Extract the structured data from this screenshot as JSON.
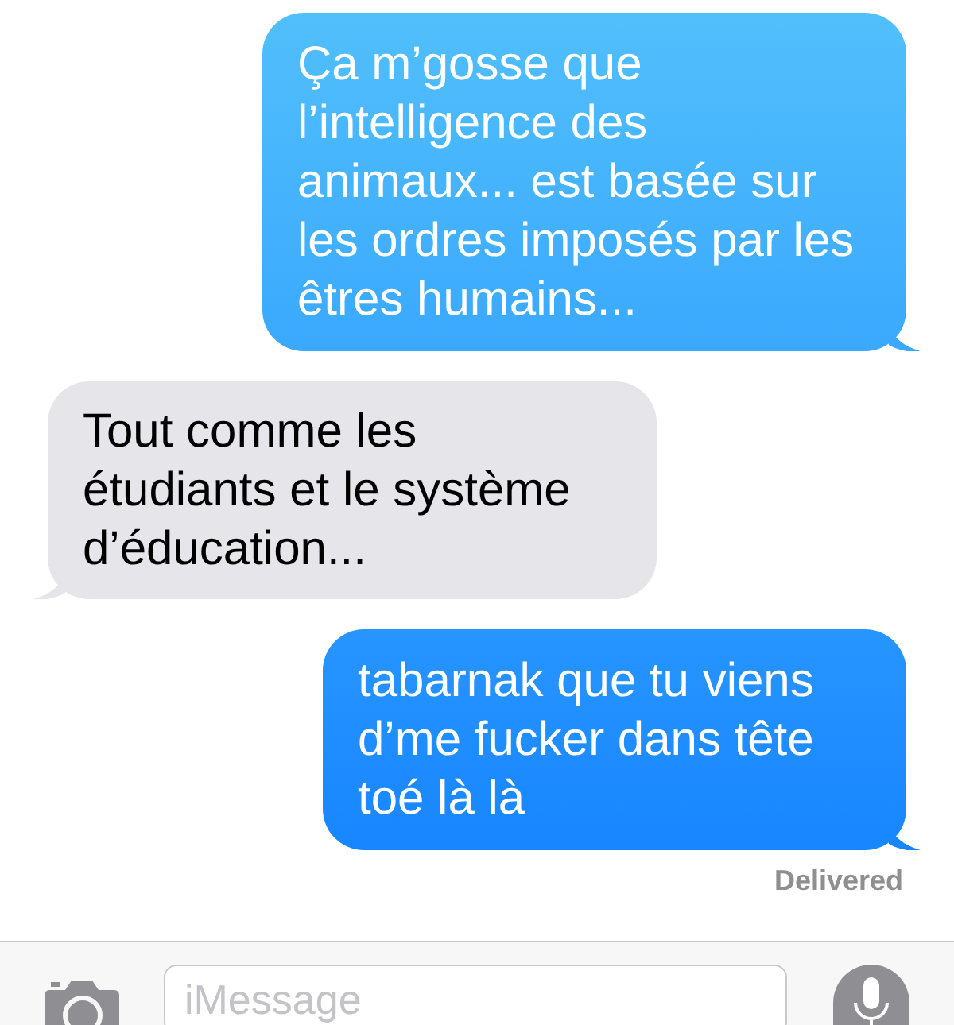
{
  "messages": [
    {
      "kind": "sent",
      "text": "Ça m’gosse que l’intelligence des animaux... est basée sur les ordres imposés par les êtres humains..."
    },
    {
      "kind": "received",
      "text": "Tout comme les étudiants et le système d’éducation..."
    },
    {
      "kind": "sent",
      "text": "tabarnak que tu viens d’me fucker dans tête toé là là"
    }
  ],
  "delivery_status": "Delivered",
  "composer": {
    "placeholder": "iMessage"
  }
}
